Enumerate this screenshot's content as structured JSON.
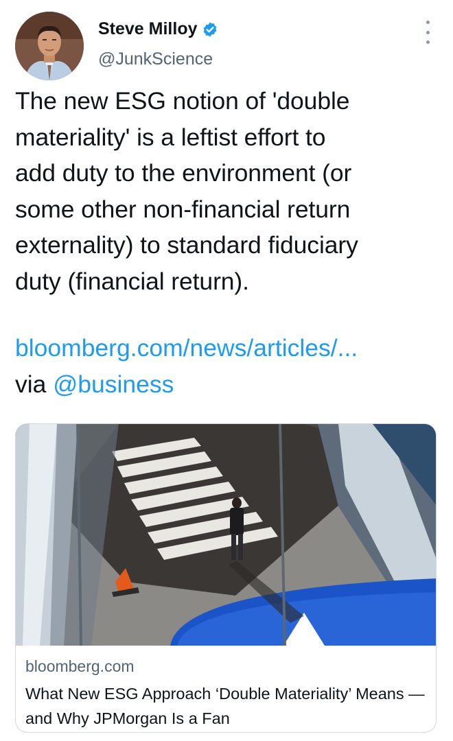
{
  "author": {
    "display_name": "Steve Milloy",
    "handle": "@JunkScience",
    "verified": true,
    "avatar_icon": "profile-photo-avatar"
  },
  "tweet": {
    "text": "The new ESG notion of 'double\nmateriality' is a leftist  effort to\nadd duty to the environment (or\nsome other non-financial return\nexternality) to standard fiduciary\nduty (financial return).",
    "link_text": "bloomberg.com/news/articles/...",
    "via_prefix": "via ",
    "via_mention": "@business"
  },
  "link_card": {
    "domain": "bloomberg.com",
    "title": "What New ESG Approach ‘Double Materiality’ Means — and Why JPMorgan Is a Fan",
    "image_icon": "street-crosswalk-photo"
  },
  "colors": {
    "text": "#0f1419",
    "secondary": "#536471",
    "link": "#1d9bf0",
    "verified_badge": "#1d9bf0",
    "border": "#cfd9de"
  },
  "icons": [
    "verified-badge-icon",
    "more-options-icon"
  ]
}
